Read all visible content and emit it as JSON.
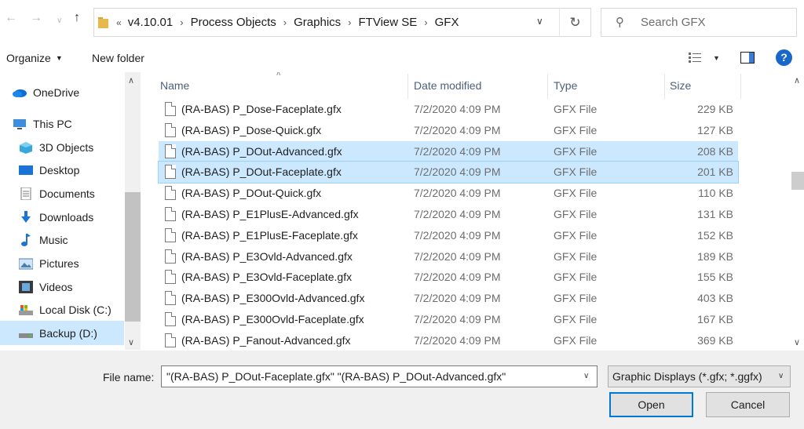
{
  "address": {
    "overflow": "«",
    "crumbs": [
      "v4.10.01",
      "Process Objects",
      "Graphics",
      "FTView SE",
      "GFX"
    ]
  },
  "search": {
    "placeholder": "Search GFX"
  },
  "toolbar": {
    "organize": "Organize",
    "new_folder": "New folder",
    "help": "?"
  },
  "nav": {
    "items": [
      {
        "label": "OneDrive",
        "icon": "onedrive-icon"
      },
      {
        "label": "This PC",
        "icon": "pc-icon"
      },
      {
        "label": "3D Objects",
        "icon": "3d-objects-icon"
      },
      {
        "label": "Desktop",
        "icon": "desktop-icon"
      },
      {
        "label": "Documents",
        "icon": "documents-icon"
      },
      {
        "label": "Downloads",
        "icon": "downloads-icon"
      },
      {
        "label": "Music",
        "icon": "music-icon"
      },
      {
        "label": "Pictures",
        "icon": "pictures-icon"
      },
      {
        "label": "Videos",
        "icon": "videos-icon"
      },
      {
        "label": "Local Disk (C:)",
        "icon": "local-disk-icon"
      },
      {
        "label": "Backup (D:)",
        "icon": "drive-icon"
      }
    ]
  },
  "columns": {
    "name": "Name",
    "date": "Date modified",
    "type": "Type",
    "size": "Size"
  },
  "files": [
    {
      "name": "(RA-BAS) P_Dose-Faceplate.gfx",
      "date": "7/2/2020 4:09 PM",
      "type": "GFX File",
      "size": "229 KB",
      "selected": false
    },
    {
      "name": "(RA-BAS) P_Dose-Quick.gfx",
      "date": "7/2/2020 4:09 PM",
      "type": "GFX File",
      "size": "127 KB",
      "selected": false
    },
    {
      "name": "(RA-BAS) P_DOut-Advanced.gfx",
      "date": "7/2/2020 4:09 PM",
      "type": "GFX File",
      "size": "208 KB",
      "selected": true
    },
    {
      "name": "(RA-BAS) P_DOut-Faceplate.gfx",
      "date": "7/2/2020 4:09 PM",
      "type": "GFX File",
      "size": "201 KB",
      "selected": true
    },
    {
      "name": "(RA-BAS) P_DOut-Quick.gfx",
      "date": "7/2/2020 4:09 PM",
      "type": "GFX File",
      "size": "110 KB",
      "selected": false
    },
    {
      "name": "(RA-BAS) P_E1PlusE-Advanced.gfx",
      "date": "7/2/2020 4:09 PM",
      "type": "GFX File",
      "size": "131 KB",
      "selected": false
    },
    {
      "name": "(RA-BAS) P_E1PlusE-Faceplate.gfx",
      "date": "7/2/2020 4:09 PM",
      "type": "GFX File",
      "size": "152 KB",
      "selected": false
    },
    {
      "name": "(RA-BAS) P_E3Ovld-Advanced.gfx",
      "date": "7/2/2020 4:09 PM",
      "type": "GFX File",
      "size": "189 KB",
      "selected": false
    },
    {
      "name": "(RA-BAS) P_E3Ovld-Faceplate.gfx",
      "date": "7/2/2020 4:09 PM",
      "type": "GFX File",
      "size": "155 KB",
      "selected": false
    },
    {
      "name": "(RA-BAS) P_E300Ovld-Advanced.gfx",
      "date": "7/2/2020 4:09 PM",
      "type": "GFX File",
      "size": "403 KB",
      "selected": false
    },
    {
      "name": "(RA-BAS) P_E300Ovld-Faceplate.gfx",
      "date": "7/2/2020 4:09 PM",
      "type": "GFX File",
      "size": "167 KB",
      "selected": false
    },
    {
      "name": "(RA-BAS) P_Fanout-Advanced.gfx",
      "date": "7/2/2020 4:09 PM",
      "type": "GFX File",
      "size": "369 KB",
      "selected": false
    }
  ],
  "bottom": {
    "file_name_label": "File name:",
    "file_name_value": "\"(RA-BAS) P_DOut-Faceplate.gfx\" \"(RA-BAS) P_DOut-Advanced.gfx\"",
    "filter_value": "Graphic Displays (*.gfx; *.ggfx)",
    "open_label": "Open",
    "cancel_label": "Cancel"
  },
  "colors": {
    "selection": "#cce8ff",
    "accent": "#0078d7",
    "folder": "#e8b84a"
  }
}
